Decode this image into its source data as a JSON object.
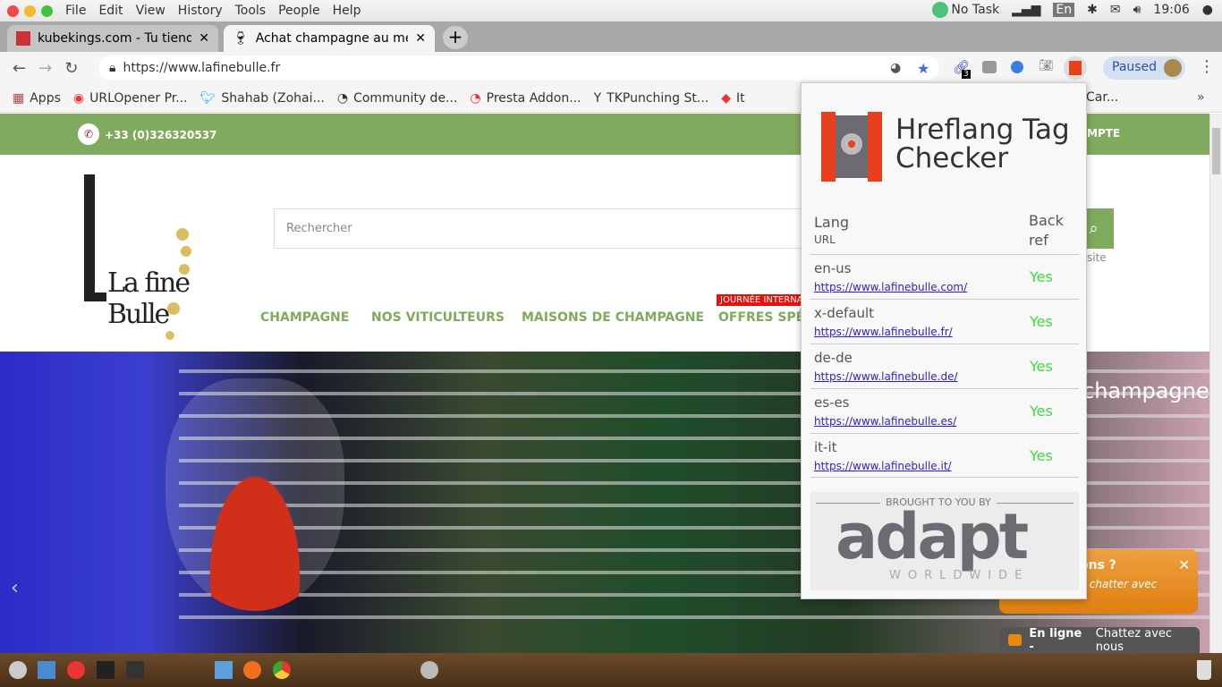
{
  "menubar": {
    "items": [
      "File",
      "Edit",
      "View",
      "History",
      "Tools",
      "People",
      "Help"
    ],
    "tray": {
      "task": "No Task",
      "lang": "En",
      "time": "19:06"
    }
  },
  "tabs": [
    {
      "title": "kubekings.com - Tu tienda",
      "icon": "kubekings-favicon"
    },
    {
      "title": "Achat champagne au meilleur prix",
      "icon": "wine-glass-icon",
      "active": true
    }
  ],
  "toolbar": {
    "url": "https://www.lafinebulle.fr",
    "profile": "Paused",
    "badge": "3"
  },
  "bookmarks": [
    "Apps",
    "URLOpener Pr...",
    "Shahab (Zohai...",
    "Community de...",
    "Presta Addon...",
    "TKPunching St...",
    "It",
    "Car..."
  ],
  "site": {
    "phone": "+33 (0)326320537",
    "account": "MPTE",
    "search_placeholder": "Rechercher",
    "search_sub": "site",
    "logo": "La fine Bulle",
    "promo": "JOURNÉE INTERNA",
    "nav": [
      "CHAMPAGNE",
      "NOS VITICULTEURS",
      "MAISONS DE CHAMPAGNE",
      "OFFRES SPÉC"
    ],
    "hero_text": "champagne"
  },
  "popup": {
    "title1": "Hreflang Tag",
    "title2": "Checker",
    "col_lang": "Lang",
    "col_url": "URL",
    "col_back1": "Back",
    "col_back2": "ref",
    "rows": [
      {
        "lang": "en-us",
        "url": "https://www.lafinebulle.com/",
        "back": "Yes"
      },
      {
        "lang": "x-default",
        "url": "https://www.lafinebulle.fr/",
        "back": "Yes"
      },
      {
        "lang": "de-de",
        "url": "https://www.lafinebulle.de/",
        "back": "Yes"
      },
      {
        "lang": "es-es",
        "url": "https://www.lafinebulle.es/",
        "back": "Yes"
      },
      {
        "lang": "it-it",
        "url": "https://www.lafinebulle.it/",
        "back": "Yes"
      }
    ],
    "brought": "BROUGHT  TO YOU BY",
    "brand": "adapt",
    "brand_sub": "WORLDWIDE"
  },
  "chat": {
    "bubble_title": "ons ?",
    "bubble_text": "r chatter avec",
    "status": "En ligne -",
    "action": "Chattez avec nous"
  },
  "colors": {
    "green": "#80ab5e",
    "orange": "#e8890f",
    "hreflang_red": "#e8401c",
    "yes": "#3ddc3d"
  }
}
